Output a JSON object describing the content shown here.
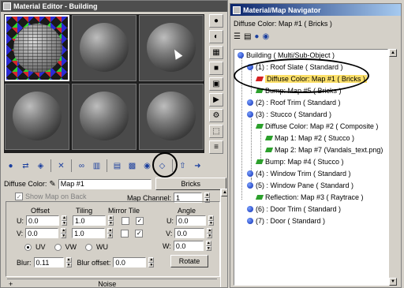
{
  "material_editor": {
    "title": "Material Editor - Building",
    "diffuse_label": "Diffuse Color:",
    "map_field": "Map #1",
    "map_type_button": "Bricks",
    "show_map_on_back": "Show Map on Back",
    "map_channel_label": "Map Channel:",
    "map_channel_value": "1",
    "offset_label": "Offset",
    "tiling_label": "Tiling",
    "mirror_tile_label": "Mirror Tile",
    "angle_label": "Angle",
    "u_label": "U:",
    "v_label": "V:",
    "w_label": "W:",
    "u_offset": "0.0",
    "v_offset": "0.0",
    "u_tiling": "1.0",
    "v_tiling": "1.0",
    "u_angle": "0.0",
    "v_angle": "0.0",
    "w_angle": "0.0",
    "uv_label": "UV",
    "vw_label": "VW",
    "wu_label": "WU",
    "blur_label": "Blur:",
    "blur_value": "0.11",
    "blur_offset_label": "Blur offset:",
    "blur_offset_value": "0.0",
    "rotate_button": "Rotate",
    "noise_label": "Noise"
  },
  "navigator": {
    "title": "Material/Map Navigator",
    "subtitle": "Diffuse Color: Map #1  ( Bricks )",
    "tree": [
      {
        "text": "Building  ( Multi/Sub-Object )"
      },
      {
        "text": "(1) : Roof Slate  ( Standard )"
      },
      {
        "text": "Diffuse Color: Map #1  ( Bricks )"
      },
      {
        "text": "Bump: Map #5  ( Bricks )"
      },
      {
        "text": "(2) : Roof Trim  ( Standard )"
      },
      {
        "text": "(3) : Stucco  ( Standard )"
      },
      {
        "text": "Diffuse Color: Map #2  ( Composite )"
      },
      {
        "text": "Map 1: Map #2  ( Stucco )"
      },
      {
        "text": "Map 2: Map #7  (Vandals_text.png)"
      },
      {
        "text": "Bump: Map #4  ( Stucco )"
      },
      {
        "text": "(4) : Window Trim  ( Standard )"
      },
      {
        "text": "(5) : Window Pane  ( Standard )"
      },
      {
        "text": "Reflection: Map #3  ( Raytrace )"
      },
      {
        "text": "(6) : Door Trim  ( Standard )"
      },
      {
        "text": "(7) : Door  ( Standard )"
      }
    ]
  }
}
